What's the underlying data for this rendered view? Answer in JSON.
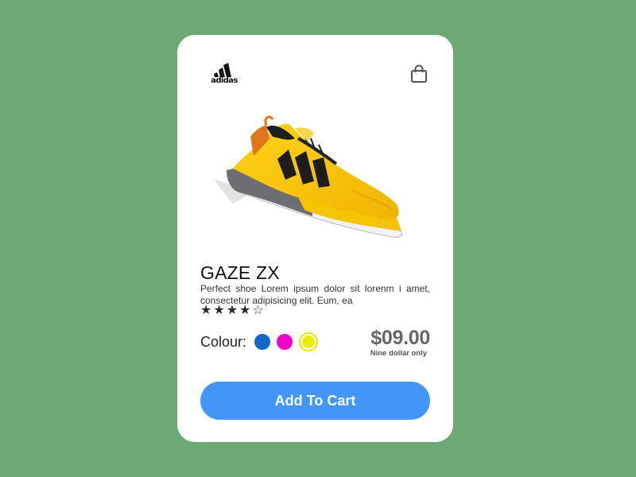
{
  "brand": {
    "name": "adidas",
    "logo_icon": "adidas-logo"
  },
  "header": {
    "cart_icon": "shopping-bag-icon"
  },
  "product": {
    "image_icon": "yellow-sneaker-image",
    "name": "GAZE ZX",
    "description": "Perfect shoe Lorem ipsum dolor sit lorenm i amet, consectetur adipisicing elit. Eum, ea",
    "rating": {
      "value": 4,
      "max": 5,
      "filled_star": "★",
      "empty_star": "☆"
    },
    "colour_label": "Colour:",
    "colours": [
      {
        "name": "blue",
        "hex": "#1167c4",
        "selected": false
      },
      {
        "name": "magenta",
        "hex": "#f200c4",
        "selected": false
      },
      {
        "name": "yellow",
        "hex": "#eaf000",
        "selected": true
      }
    ],
    "price": "$09.00",
    "price_note": "Nine dollar only"
  },
  "actions": {
    "add_to_cart_label": "Add To Cart"
  },
  "colors": {
    "background": "#6ba873",
    "card": "#ffffff",
    "button": "#4196f7",
    "price": "#666666"
  }
}
